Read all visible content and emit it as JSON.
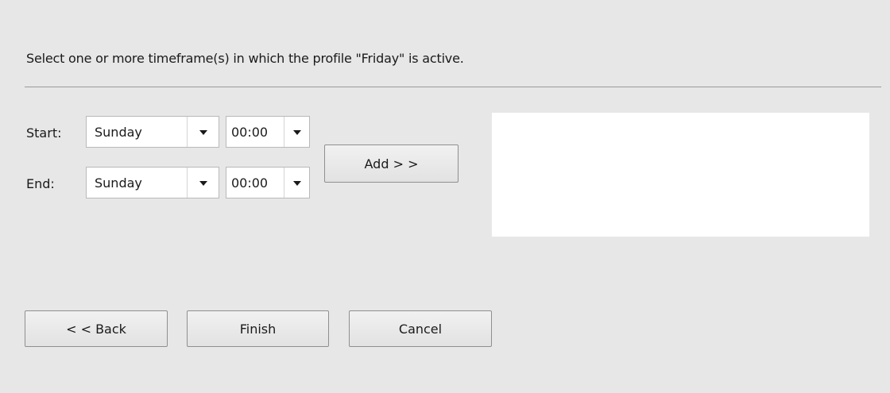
{
  "instruction": "Select one or more timeframe(s) in which the profile \"Friday\" is active.",
  "start": {
    "label": "Start:",
    "day": "Sunday",
    "time": "00:00",
    "day_icon": "chevron-down-icon",
    "time_icon": "chevron-down-icon"
  },
  "end": {
    "label": "End:",
    "day": "Sunday",
    "time": "00:00",
    "day_icon": "chevron-down-icon",
    "time_icon": "chevron-down-icon"
  },
  "add_button": "Add > >",
  "timeframe_list": [],
  "footer": {
    "back": "< < Back",
    "finish": "Finish",
    "cancel": "Cancel"
  }
}
